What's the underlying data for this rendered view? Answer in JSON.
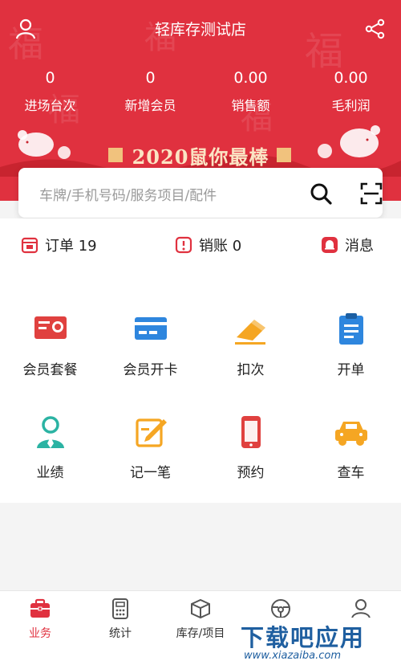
{
  "header": {
    "title": "轻库存测试店",
    "banner": "2020鼠你最棒",
    "stats": [
      {
        "value": "0",
        "label": "进场台次"
      },
      {
        "value": "0",
        "label": "新增会员"
      },
      {
        "value": "0.00",
        "label": "销售额"
      },
      {
        "value": "0.00",
        "label": "毛利润"
      }
    ]
  },
  "search": {
    "placeholder": "车牌/手机号码/服务项目/配件"
  },
  "quick": [
    {
      "label": "订单 19"
    },
    {
      "label": "销账 0"
    },
    {
      "label": "消息"
    }
  ],
  "grid": [
    {
      "label": "会员套餐",
      "icon": "certificate-icon"
    },
    {
      "label": "会员开卡",
      "icon": "card-icon"
    },
    {
      "label": "扣次",
      "icon": "eraser-icon"
    },
    {
      "label": "开单",
      "icon": "clipboard-icon"
    },
    {
      "label": "业绩",
      "icon": "person-icon"
    },
    {
      "label": "记一笔",
      "icon": "note-icon"
    },
    {
      "label": "预约",
      "icon": "phone-icon"
    },
    {
      "label": "查车",
      "icon": "car-icon"
    }
  ],
  "tabs": [
    {
      "label": "业务",
      "icon": "briefcase-icon",
      "active": true
    },
    {
      "label": "统计",
      "icon": "calculator-icon"
    },
    {
      "label": "库存/项目",
      "icon": "box-icon"
    },
    {
      "label": "",
      "icon": "steering-wheel-icon"
    },
    {
      "label": "",
      "icon": "profile-icon"
    }
  ],
  "watermark": {
    "brand": "下载吧应用",
    "url": "www.xiazaiba.com"
  },
  "colors": {
    "accent": "#e0313f",
    "blue": "#2e86de",
    "orange": "#f5a623",
    "green": "#2bb3a3"
  }
}
